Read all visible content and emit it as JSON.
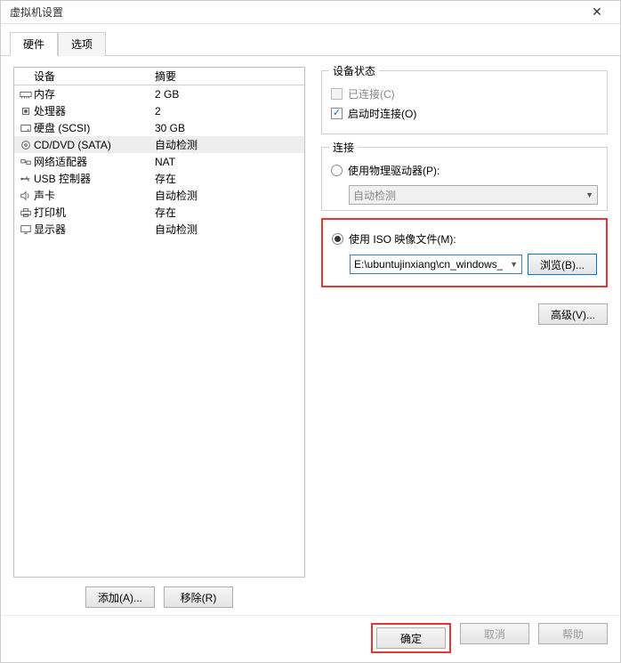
{
  "window": {
    "title": "虚拟机设置"
  },
  "tabs": {
    "hardware": "硬件",
    "options": "选项"
  },
  "deviceHeader": {
    "device": "设备",
    "summary": "摘要"
  },
  "devices": [
    {
      "name": "内存",
      "summary": "2 GB",
      "icon": "memory"
    },
    {
      "name": "处理器",
      "summary": "2",
      "icon": "cpu"
    },
    {
      "name": "硬盘 (SCSI)",
      "summary": "30 GB",
      "icon": "hdd"
    },
    {
      "name": "CD/DVD (SATA)",
      "summary": "自动检测",
      "icon": "cd",
      "selected": true
    },
    {
      "name": "网络适配器",
      "summary": "NAT",
      "icon": "net"
    },
    {
      "name": "USB 控制器",
      "summary": "存在",
      "icon": "usb"
    },
    {
      "name": "声卡",
      "summary": "自动检测",
      "icon": "sound"
    },
    {
      "name": "打印机",
      "summary": "存在",
      "icon": "printer"
    },
    {
      "name": "显示器",
      "summary": "自动检测",
      "icon": "display"
    }
  ],
  "buttons": {
    "add": "添加(A)...",
    "remove": "移除(R)",
    "browse": "浏览(B)...",
    "advanced": "高级(V)...",
    "ok": "确定",
    "cancel": "取消",
    "help": "帮助"
  },
  "status": {
    "legend": "设备状态",
    "connected": "已连接(C)",
    "connectAtPowerOn": "启动时连接(O)"
  },
  "connection": {
    "legend": "连接",
    "usePhysical": "使用物理驱动器(P):",
    "autoDetect": "自动检测",
    "useIso": "使用 ISO 映像文件(M):",
    "isoPath": "E:\\ubuntujinxiang\\cn_windows_"
  }
}
